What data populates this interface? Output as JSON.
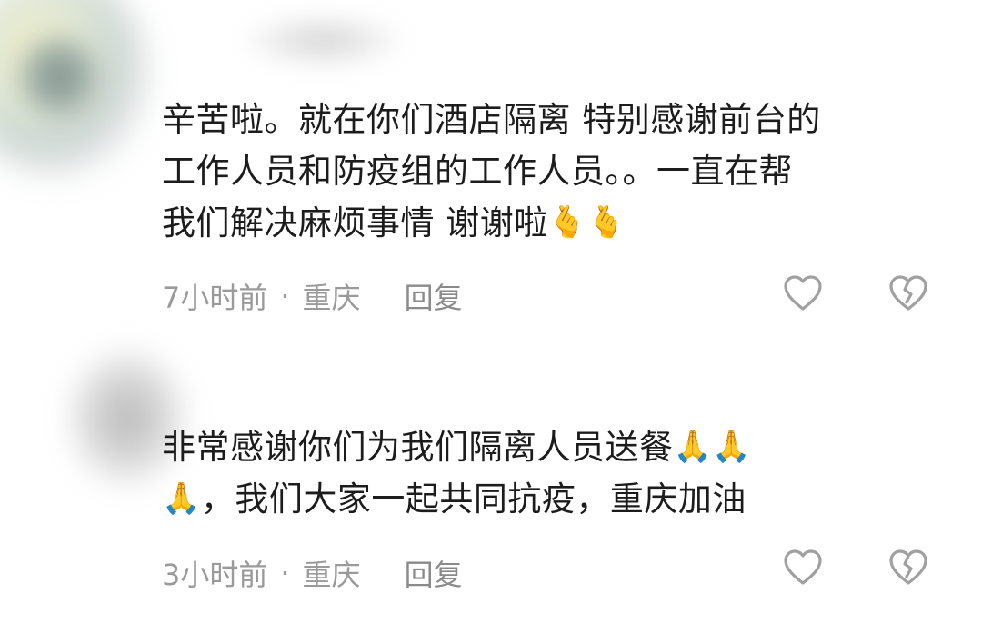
{
  "comments": [
    {
      "lines": [
        "辛苦啦。就在你们酒店隔离 特别感谢前台的",
        "工作人员和防疫组的工作人员。。一直在帮",
        "我们解决麻烦事情 谢谢啦"
      ],
      "trailing_emoji": [
        "🫰",
        "🫰"
      ],
      "time": "7小时前",
      "separator": "·",
      "location": "重庆",
      "reply_label": "回复",
      "like_icon": "heart-outline-icon",
      "dislike_icon": "broken-heart-icon"
    },
    {
      "lines": [
        "非常感谢你们为我们隔离人员送餐",
        "，我们大家一起共同抗疫，重庆加油"
      ],
      "line1_emoji": [
        "🙏",
        "🙏"
      ],
      "line2_leading_emoji": "🙏",
      "time": "3小时前",
      "separator": "·",
      "location": "重庆",
      "reply_label": "回复",
      "like_icon": "heart-outline-icon",
      "dislike_icon": "broken-heart-icon"
    }
  ],
  "colors": {
    "text": "#1c1c1c",
    "meta": "#9a9a9a",
    "icon": "#a0a0a0",
    "background": "#ffffff"
  }
}
